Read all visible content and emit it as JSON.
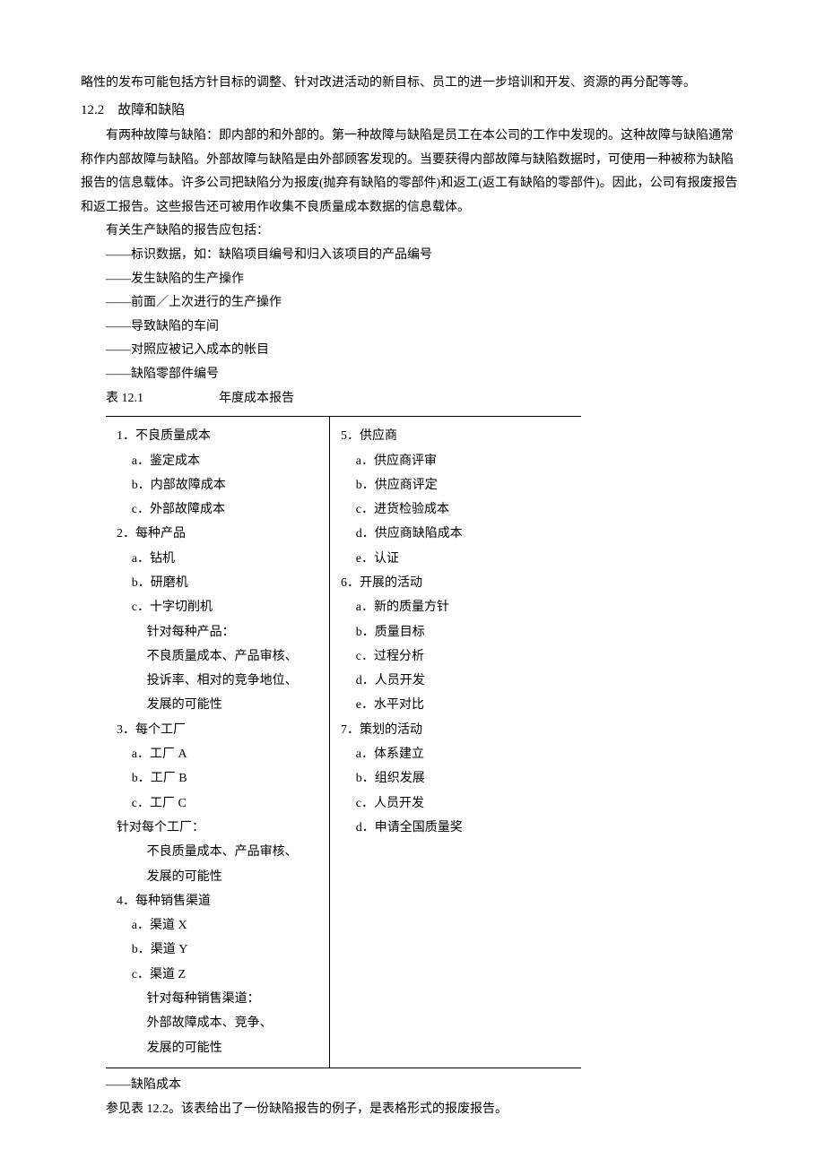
{
  "intro_line": "略性的发布可能包括方针目标的调整、针对改进活动的新目标、员工的进一步培训和开发、资源的再分配等等。",
  "section_number": "12.2",
  "section_title": "故障和缺陷",
  "p1": "有两种故障与缺陷：即内部的和外部的。第一种故障与缺陷是员工在本公司的工作中发现的。这种故障与缺陷通常称作内部故障与缺陷。外部故障与缺陷是由外部顾客发现的。当要获得内部故障与缺陷数据时，可使用一种被称为缺陷报告的信息载体。许多公司把缺陷分为报废(抛弃有缺陷的零部件)和返工(返工有缺陷的零部件)。因此，公司有报废报告和返工报告。这些报告还可被用作收集不良质量成本数据的信息载体。",
  "p2": "有关生产缺陷的报告应包括：",
  "bullets": [
    "——标识数据，如：缺陷项目编号和归入该项目的产品编号",
    "——发生缺陷的生产操作",
    "——前面／上次进行的生产操作",
    "——导致缺陷的车间",
    "——对照应被记入成本的帐目",
    "——缺陷零部件编号"
  ],
  "table_caption": "表 12.1　　　　　　年度成本报告",
  "left_col": [
    {
      "t": "1．不良质量成本",
      "l": 1
    },
    {
      "t": "a．鉴定成本",
      "l": 2
    },
    {
      "t": "b．内部故障成本",
      "l": 2
    },
    {
      "t": "c．外部故障成本",
      "l": 2
    },
    {
      "t": "2．每种产品",
      "l": 1
    },
    {
      "t": "a．钻机",
      "l": 2
    },
    {
      "t": "b．研磨机",
      "l": 2
    },
    {
      "t": "c．十字切削机",
      "l": 2
    },
    {
      "t": "针对每种产品：",
      "l": 3
    },
    {
      "t": "不良质量成本、产品审核、",
      "l": 3
    },
    {
      "t": "投诉率、相对的竞争地位、",
      "l": 3
    },
    {
      "t": "发展的可能性",
      "l": 3
    },
    {
      "t": "3．每个工厂",
      "l": 1
    },
    {
      "t": "a．工厂 A",
      "l": 2
    },
    {
      "t": "b．工厂 B",
      "l": 2
    },
    {
      "t": "c．工厂 C",
      "l": 2
    },
    {
      "t": "针对每个工厂：",
      "l": 1
    },
    {
      "t": "不良质量成本、产品审核、",
      "l": 3
    },
    {
      "t": "发展的可能性",
      "l": 3
    },
    {
      "t": "4．每种销售渠道",
      "l": 1
    },
    {
      "t": "a．渠道 X",
      "l": 2
    },
    {
      "t": "b．渠道 Y",
      "l": 2
    },
    {
      "t": "c．渠道 Z",
      "l": 2
    },
    {
      "t": "针对每种销售渠道：",
      "l": 3
    },
    {
      "t": "外部故障成本、竞争、",
      "l": 3
    },
    {
      "t": "发展的可能性",
      "l": 3
    }
  ],
  "right_col": [
    {
      "t": "5．供应商",
      "l": 1
    },
    {
      "t": "a．供应商评审",
      "l": 2
    },
    {
      "t": "b．供应商评定",
      "l": 2
    },
    {
      "t": "c．进货检验成本",
      "l": 2
    },
    {
      "t": "d．供应商缺陷成本",
      "l": 2
    },
    {
      "t": "e．认证",
      "l": 2
    },
    {
      "t": "6．开展的活动",
      "l": 1
    },
    {
      "t": "a．新的质量方针",
      "l": 2
    },
    {
      "t": "b．质量目标",
      "l": 2
    },
    {
      "t": "c．过程分析",
      "l": 2
    },
    {
      "t": "d．人员开发",
      "l": 2
    },
    {
      "t": "e．水平对比",
      "l": 2
    },
    {
      "t": "7．策划的活动",
      "l": 1
    },
    {
      "t": "a．体系建立",
      "l": 2
    },
    {
      "t": "b．组织发展",
      "l": 2
    },
    {
      "t": "c．人员开发",
      "l": 2
    },
    {
      "t": "d．申请全国质量奖",
      "l": 2
    }
  ],
  "after1": "——缺陷成本",
  "after2": "参见表 12.2。该表给出了一份缺陷报告的例子，是表格形式的报废报告。"
}
